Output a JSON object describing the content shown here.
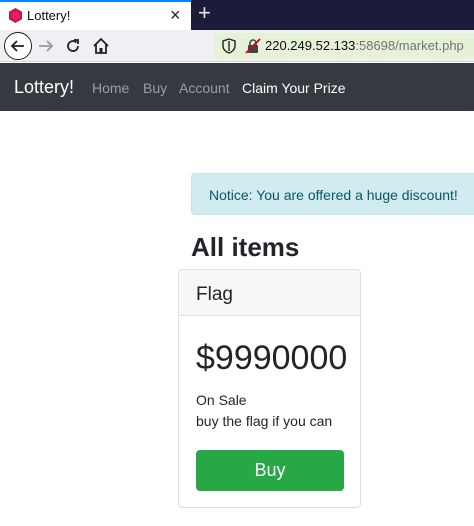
{
  "browser": {
    "tab_title": "Lottery!",
    "new_tab_label": "+",
    "tab_close_label": "×",
    "url_host": "220.249.52.133",
    "url_rest": ":58698/market.php"
  },
  "navbar": {
    "brand": "Lottery!",
    "links": [
      {
        "label": "Home"
      },
      {
        "label": "Buy"
      },
      {
        "label": "Account"
      },
      {
        "label": "Claim Your Prize"
      }
    ]
  },
  "notice": {
    "text": "Notice: You are offered a huge discount!"
  },
  "main": {
    "heading": "All items",
    "card": {
      "title": "Flag",
      "price": "$9990000",
      "line1": "On Sale",
      "line2": "buy the flag if you can",
      "button": "Buy"
    }
  },
  "colors": {
    "navbar_bg": "#343a40",
    "notice_bg": "#d1ecf1",
    "button_bg": "#28a745",
    "url_bg": "#e5f2d8"
  }
}
